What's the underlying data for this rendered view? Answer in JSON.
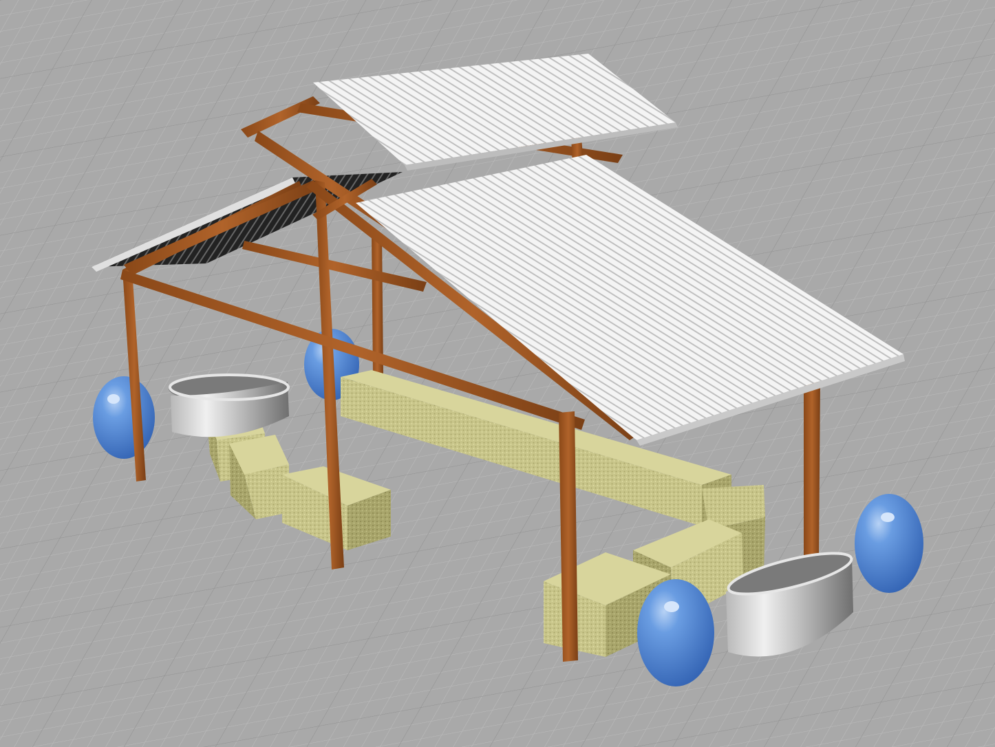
{
  "viewport": {
    "label": "",
    "display_mode": "rendered",
    "background_color": "#a9a9a9",
    "grid_minor_color": "#bdbdbd",
    "grid_major_color": "#8f8f8f",
    "grid_visible": true
  },
  "scene": {
    "description_objects": [
      "pavilion-frame",
      "corrugated-roof",
      "hay-bales",
      "blue-barrels",
      "stock-tanks"
    ],
    "colors": {
      "timber": "#a0561f",
      "timber_dark": "#6e3a14",
      "roof": "#f2f2f2",
      "roof_shadow": "#cfcfcf",
      "roof_underside": "#2a2a2a",
      "hay": "#c8c58a",
      "hay_dark": "#9c9a62",
      "barrel": "#4f86d6",
      "barrel_highlight": "#a9c8f2",
      "tank": "#d8d8d8",
      "tank_dark": "#9a9a9a"
    },
    "barrel_count": 4,
    "stock_tank_count": 2,
    "hay_bale_count": 14
  }
}
